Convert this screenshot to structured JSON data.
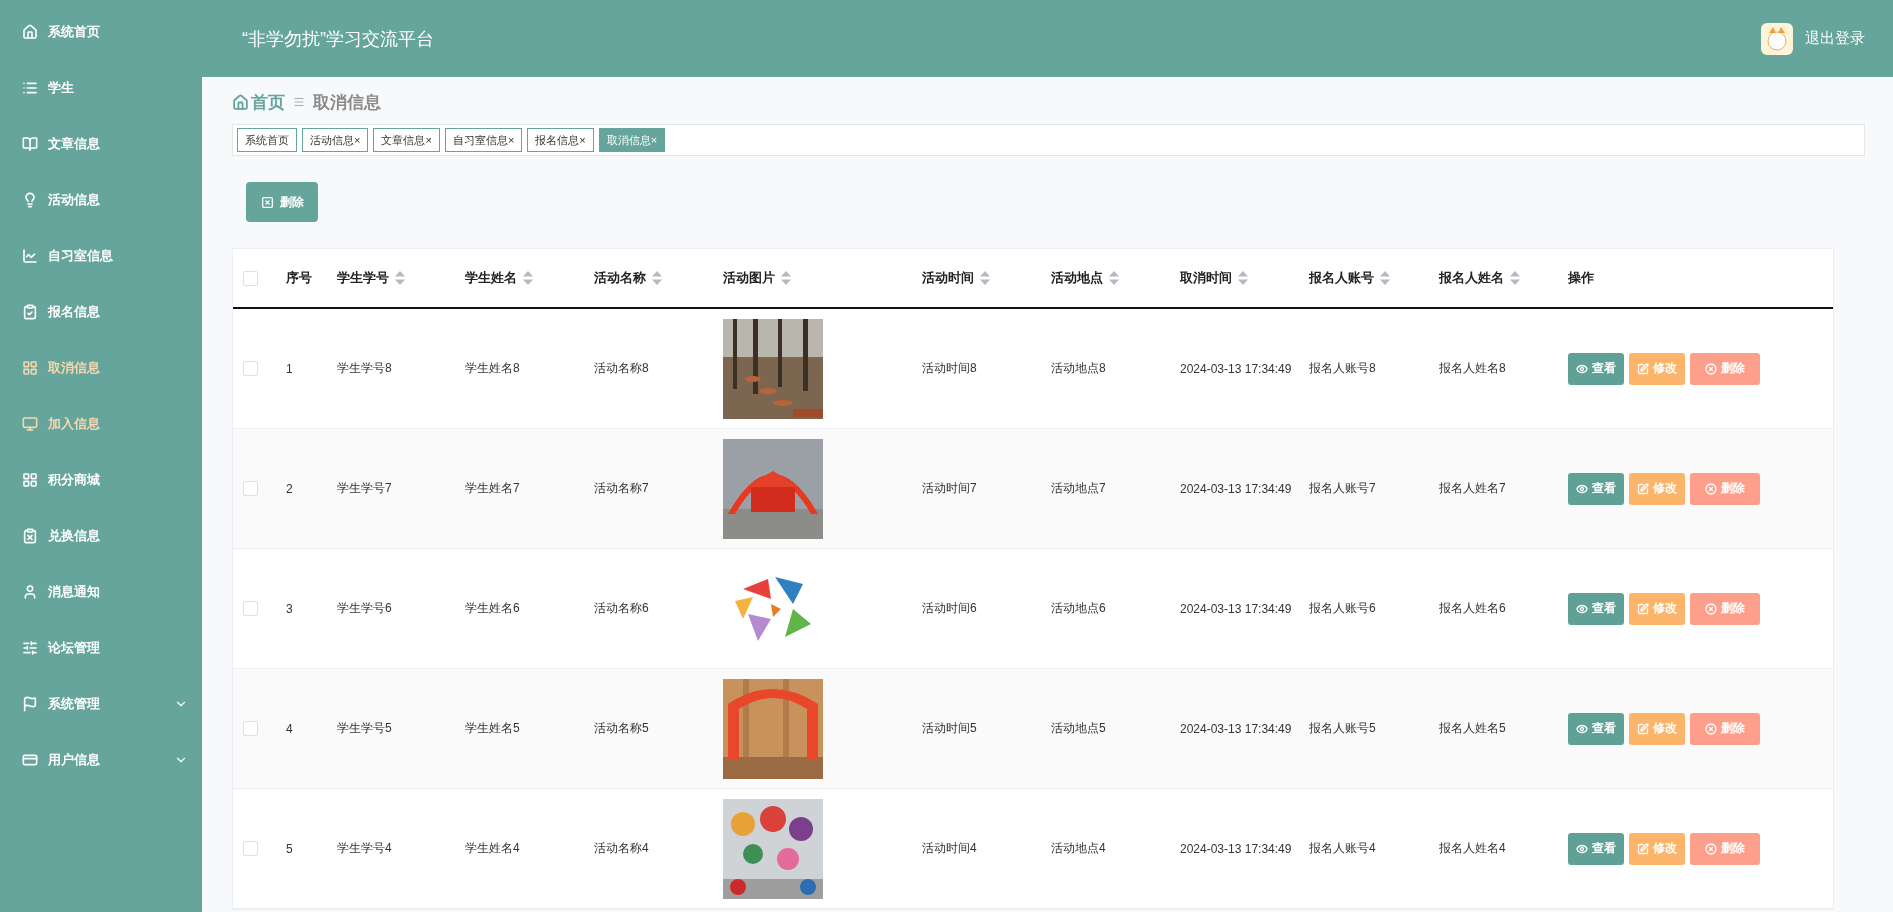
{
  "header": {
    "title": "“非学勿扰”学习交流平台",
    "logout": "退出登录"
  },
  "sidebar": {
    "items": [
      {
        "label": "系统首页",
        "highlighted": false,
        "expandable": false
      },
      {
        "label": "学生",
        "highlighted": false,
        "expandable": false
      },
      {
        "label": "文章信息",
        "highlighted": false,
        "expandable": false
      },
      {
        "label": "活动信息",
        "highlighted": false,
        "expandable": false
      },
      {
        "label": "自习室信息",
        "highlighted": false,
        "expandable": false
      },
      {
        "label": "报名信息",
        "highlighted": false,
        "expandable": false
      },
      {
        "label": "取消信息",
        "highlighted": true,
        "expandable": false
      },
      {
        "label": "加入信息",
        "highlighted": true,
        "expandable": false
      },
      {
        "label": "积分商城",
        "highlighted": false,
        "expandable": false
      },
      {
        "label": "兑换信息",
        "highlighted": false,
        "expandable": false
      },
      {
        "label": "消息通知",
        "highlighted": false,
        "expandable": false
      },
      {
        "label": "论坛管理",
        "highlighted": false,
        "expandable": false
      },
      {
        "label": "系统管理",
        "highlighted": false,
        "expandable": true
      },
      {
        "label": "用户信息",
        "highlighted": false,
        "expandable": true
      }
    ]
  },
  "breadcrumb": {
    "home": "首页",
    "current": "取消信息"
  },
  "tabs": [
    {
      "label": "系统首页",
      "selected": false
    },
    {
      "label": "活动信息",
      "selected": false,
      "close": "×"
    },
    {
      "label": "文章信息",
      "selected": false,
      "close": "×"
    },
    {
      "label": "自习室信息",
      "selected": false,
      "close": "×"
    },
    {
      "label": "报名信息",
      "selected": false,
      "close": "×"
    },
    {
      "label": "取消信息",
      "selected": true,
      "close": "×"
    }
  ],
  "toolbar": {
    "delete_button": "删除"
  },
  "table": {
    "select_all_checked": false,
    "columns": [
      {
        "kind": "text",
        "label": "序号",
        "sortable": false
      },
      {
        "kind": "text",
        "label": "学生学号",
        "sortable": true
      },
      {
        "kind": "text",
        "label": "学生姓名",
        "sortable": true
      },
      {
        "kind": "text",
        "label": "活动名称",
        "sortable": true
      },
      {
        "kind": "picture",
        "label": "活动图片",
        "sortable": true
      },
      {
        "kind": "text",
        "label": "活动时间",
        "sortable": true
      },
      {
        "kind": "text",
        "label": "活动地点",
        "sortable": true
      },
      {
        "kind": "text",
        "label": "取消时间",
        "sortable": true
      },
      {
        "kind": "text",
        "label": "报名人账号",
        "sortable": true
      },
      {
        "kind": "text",
        "label": "报名人姓名",
        "sortable": true
      },
      {
        "kind": "actions",
        "label": "操作",
        "sortable": false
      }
    ],
    "rows": [
      {
        "checked": false,
        "cells": [
          "1",
          "学生学号8",
          "学生姓名8",
          "活动名称8",
          {
            "kind": "picture"
          },
          "活动时间8",
          "活动地点8",
          "2024-03-13 17:34:49",
          "报名人账号8",
          "报名人姓名8",
          [
            {
              "kind": "view",
              "label": "查看"
            },
            {
              "kind": "edit",
              "label": "修改"
            },
            {
              "kind": "delete",
              "label": "删除"
            }
          ]
        ]
      },
      {
        "checked": false,
        "cells": [
          "2",
          "学生学号7",
          "学生姓名7",
          "活动名称7",
          {
            "kind": "picture"
          },
          "活动时间7",
          "活动地点7",
          "2024-03-13 17:34:49",
          "报名人账号7",
          "报名人姓名7",
          [
            {
              "kind": "view",
              "label": "查看"
            },
            {
              "kind": "edit",
              "label": "修改"
            },
            {
              "kind": "delete",
              "label": "删除"
            }
          ]
        ]
      },
      {
        "checked": false,
        "cells": [
          "3",
          "学生学号6",
          "学生姓名6",
          "活动名称6",
          {
            "kind": "picture"
          },
          "活动时间6",
          "活动地点6",
          "2024-03-13 17:34:49",
          "报名人账号6",
          "报名人姓名6",
          [
            {
              "kind": "view",
              "label": "查看"
            },
            {
              "kind": "edit",
              "label": "修改"
            },
            {
              "kind": "delete",
              "label": "删除"
            }
          ]
        ]
      },
      {
        "checked": false,
        "cells": [
          "4",
          "学生学号5",
          "学生姓名5",
          "活动名称5",
          {
            "kind": "picture"
          },
          "活动时间5",
          "活动地点5",
          "2024-03-13 17:34:49",
          "报名人账号5",
          "报名人姓名5",
          [
            {
              "kind": "view",
              "label": "查看"
            },
            {
              "kind": "edit",
              "label": "修改"
            },
            {
              "kind": "delete",
              "label": "删除"
            }
          ]
        ]
      },
      {
        "checked": false,
        "cells": [
          "5",
          "学生学号4",
          "学生姓名4",
          "活动名称4",
          {
            "kind": "picture"
          },
          "活动时间4",
          "活动地点4",
          "2024-03-13 17:34:49",
          "报名人账号4",
          "报名人姓名4",
          [
            {
              "kind": "view",
              "label": "查看"
            },
            {
              "kind": "edit",
              "label": "修改"
            },
            {
              "kind": "delete",
              "label": "删除"
            }
          ]
        ]
      }
    ]
  }
}
